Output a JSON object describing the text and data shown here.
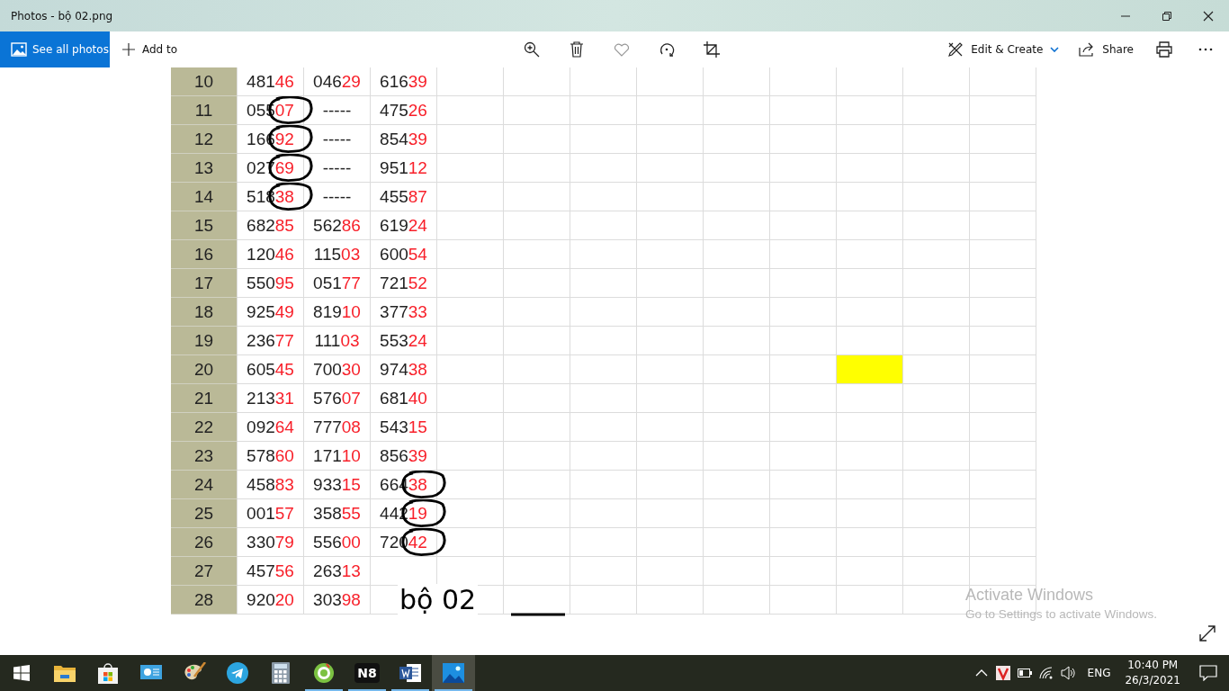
{
  "window": {
    "title": "Photos - bộ 02.png"
  },
  "toolbar": {
    "see_all": "See all photos",
    "add_to": "Add to",
    "edit_create": "Edit & Create",
    "share": "Share"
  },
  "sheet": {
    "annotation": "bộ 02",
    "rows": [
      {
        "num": "10",
        "cells": [
          {
            "head": "481",
            "tail": "46",
            "circled": false
          },
          {
            "head": "046",
            "tail": "29",
            "circled": false
          },
          {
            "head": "616",
            "tail": "39",
            "circled": false
          }
        ],
        "filled": [
          false,
          false,
          false,
          false,
          false,
          false,
          false,
          false,
          false
        ]
      },
      {
        "num": "11",
        "cells": [
          {
            "head": "055",
            "tail": "07",
            "circled": true
          },
          {
            "head": "-----",
            "circled": false
          },
          {
            "head": "475",
            "tail": "26",
            "circled": false
          }
        ],
        "filled": [
          false,
          false,
          false,
          false,
          false,
          false,
          false,
          false,
          false
        ]
      },
      {
        "num": "12",
        "cells": [
          {
            "head": "166",
            "tail": "92",
            "circled": true
          },
          {
            "head": "-----",
            "circled": false
          },
          {
            "head": "854",
            "tail": "39",
            "circled": false
          }
        ],
        "filled": [
          false,
          false,
          false,
          false,
          false,
          false,
          false,
          false,
          false
        ]
      },
      {
        "num": "13",
        "cells": [
          {
            "head": "027",
            "tail": "69",
            "circled": true
          },
          {
            "head": "-----",
            "circled": false
          },
          {
            "head": "951",
            "tail": "12",
            "circled": false
          }
        ],
        "filled": [
          false,
          false,
          false,
          false,
          false,
          false,
          false,
          false,
          false
        ]
      },
      {
        "num": "14",
        "cells": [
          {
            "head": "518",
            "tail": "38",
            "circled": true
          },
          {
            "head": "-----",
            "circled": false
          },
          {
            "head": "455",
            "tail": "87",
            "circled": false
          }
        ],
        "filled": [
          false,
          false,
          false,
          false,
          false,
          false,
          false,
          false,
          false
        ]
      },
      {
        "num": "15",
        "cells": [
          {
            "head": "682",
            "tail": "85",
            "circled": false
          },
          {
            "head": "562",
            "tail": "86",
            "circled": false
          },
          {
            "head": "619",
            "tail": "24",
            "circled": false
          }
        ],
        "filled": [
          false,
          false,
          false,
          false,
          false,
          false,
          false,
          false,
          false
        ]
      },
      {
        "num": "16",
        "cells": [
          {
            "head": "120",
            "tail": "46",
            "circled": false
          },
          {
            "head": "115",
            "tail": "03",
            "circled": false
          },
          {
            "head": "600",
            "tail": "54",
            "circled": false
          }
        ],
        "filled": [
          false,
          false,
          false,
          false,
          false,
          false,
          false,
          false,
          false
        ]
      },
      {
        "num": "17",
        "cells": [
          {
            "head": "550",
            "tail": "95",
            "circled": false
          },
          {
            "head": "051",
            "tail": "77",
            "circled": false
          },
          {
            "head": "721",
            "tail": "52",
            "circled": false
          }
        ],
        "filled": [
          false,
          false,
          false,
          false,
          false,
          false,
          false,
          false,
          false
        ]
      },
      {
        "num": "18",
        "cells": [
          {
            "head": "925",
            "tail": "49",
            "circled": false
          },
          {
            "head": "819",
            "tail": "10",
            "circled": false
          },
          {
            "head": "377",
            "tail": "33",
            "circled": false
          }
        ],
        "filled": [
          false,
          false,
          false,
          false,
          false,
          false,
          false,
          false,
          false
        ]
      },
      {
        "num": "19",
        "cells": [
          {
            "head": "236",
            "tail": "77",
            "circled": false
          },
          {
            "head": "111",
            "tail": "03",
            "circled": false
          },
          {
            "head": "553",
            "tail": "24",
            "circled": false
          }
        ],
        "filled": [
          false,
          false,
          false,
          false,
          false,
          false,
          false,
          false,
          false
        ]
      },
      {
        "num": "20",
        "cells": [
          {
            "head": "605",
            "tail": "45",
            "circled": false
          },
          {
            "head": "700",
            "tail": "30",
            "circled": false
          },
          {
            "head": "974",
            "tail": "38",
            "circled": false
          }
        ],
        "filled": [
          false,
          false,
          false,
          false,
          false,
          false,
          true,
          false,
          false
        ]
      },
      {
        "num": "21",
        "cells": [
          {
            "head": "213",
            "tail": "31",
            "circled": false
          },
          {
            "head": "576",
            "tail": "07",
            "circled": false
          },
          {
            "head": "681",
            "tail": "40",
            "circled": false
          }
        ],
        "filled": [
          false,
          false,
          false,
          false,
          false,
          false,
          false,
          false,
          false
        ]
      },
      {
        "num": "22",
        "cells": [
          {
            "head": "092",
            "tail": "64",
            "circled": false
          },
          {
            "head": "777",
            "tail": "08",
            "circled": false
          },
          {
            "head": "543",
            "tail": "15",
            "circled": false
          }
        ],
        "filled": [
          false,
          false,
          false,
          false,
          false,
          false,
          false,
          false,
          false
        ]
      },
      {
        "num": "23",
        "cells": [
          {
            "head": "578",
            "tail": "60",
            "circled": false
          },
          {
            "head": "171",
            "tail": "10",
            "circled": false
          },
          {
            "head": "856",
            "tail": "39",
            "circled": false
          }
        ],
        "filled": [
          false,
          false,
          false,
          false,
          false,
          false,
          false,
          false,
          false
        ]
      },
      {
        "num": "24",
        "cells": [
          {
            "head": "458",
            "tail": "83",
            "circled": false
          },
          {
            "head": "933",
            "tail": "15",
            "circled": false
          },
          {
            "head": "664",
            "tail": "38",
            "circled": true
          }
        ],
        "filled": [
          false,
          false,
          false,
          false,
          false,
          false,
          false,
          false,
          false
        ]
      },
      {
        "num": "25",
        "cells": [
          {
            "head": "001",
            "tail": "57",
            "circled": false
          },
          {
            "head": "358",
            "tail": "55",
            "circled": false
          },
          {
            "head": "442",
            "tail": "19",
            "circled": true
          }
        ],
        "filled": [
          false,
          false,
          false,
          false,
          false,
          false,
          false,
          false,
          false
        ]
      },
      {
        "num": "26",
        "cells": [
          {
            "head": "330",
            "tail": "79",
            "circled": false
          },
          {
            "head": "556",
            "tail": "00",
            "circled": false
          },
          {
            "head": "720",
            "tail": "42",
            "circled": true
          }
        ],
        "filled": [
          false,
          false,
          false,
          false,
          false,
          false,
          false,
          false,
          false
        ]
      },
      {
        "num": "27",
        "cells": [
          {
            "head": "457",
            "tail": "56",
            "circled": false
          },
          {
            "head": "263",
            "tail": "13",
            "circled": false
          }
        ],
        "filled": [
          false,
          false,
          false,
          false,
          false,
          false,
          false,
          false,
          false
        ]
      },
      {
        "num": "28",
        "cells": [
          {
            "head": "920",
            "tail": "20",
            "circled": false
          },
          {
            "head": "303",
            "tail": "98",
            "circled": false
          }
        ],
        "filled": [
          false,
          false,
          false,
          false,
          false,
          false,
          false,
          false,
          false
        ]
      }
    ]
  },
  "activation": {
    "title": "Activate Windows",
    "subtitle": "Go to Settings to activate Windows."
  },
  "taskbar": {
    "apps": [
      {
        "kind": "explorer",
        "open": false,
        "selected": false
      },
      {
        "kind": "store",
        "open": false,
        "selected": false
      },
      {
        "kind": "presentation",
        "open": false,
        "selected": false
      },
      {
        "kind": "paint",
        "open": false,
        "selected": false
      },
      {
        "kind": "telegram",
        "open": false,
        "selected": false
      },
      {
        "kind": "calculator",
        "open": false,
        "selected": false
      },
      {
        "kind": "browser",
        "open": true,
        "selected": false
      },
      {
        "kind": "label",
        "label": "N8",
        "open": true,
        "selected": false
      },
      {
        "kind": "word",
        "open": true,
        "selected": false
      },
      {
        "kind": "photos",
        "open": true,
        "selected": true
      }
    ],
    "language": "ENG",
    "time": "10:40 PM",
    "date": "26/3/2021"
  }
}
